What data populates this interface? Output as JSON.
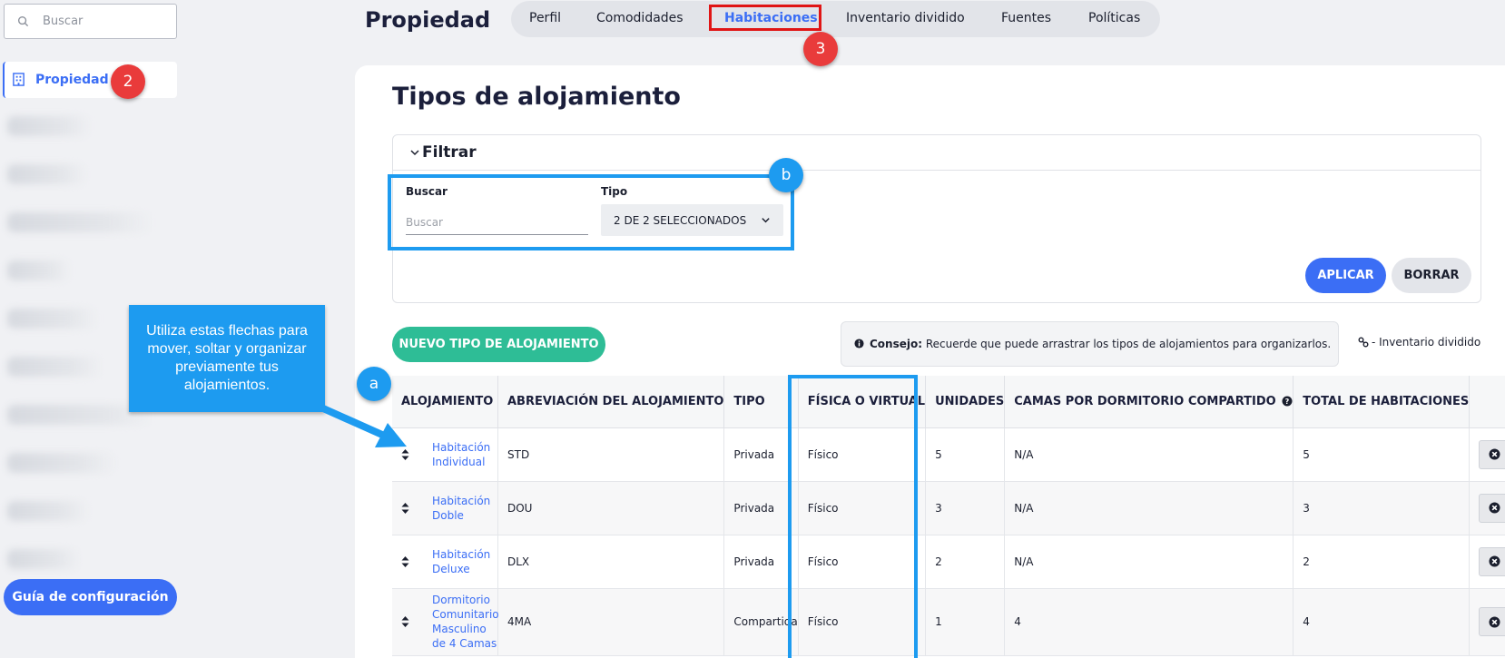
{
  "sidebar": {
    "search_placeholder": "Buscar",
    "active_item": "Propiedad",
    "guide_button": "Guía de configuración"
  },
  "header": {
    "title": "Propiedad",
    "tabs": [
      {
        "label": "Perfil"
      },
      {
        "label": "Comodidades"
      },
      {
        "label": "Habitaciones",
        "active": true
      },
      {
        "label": "Inventario dividido"
      },
      {
        "label": "Fuentes"
      },
      {
        "label": "Políticas"
      }
    ]
  },
  "main": {
    "title": "Tipos de alojamiento",
    "filter": {
      "heading": "Filtrar",
      "search_label": "Buscar",
      "search_placeholder": "Buscar",
      "type_label": "Tipo",
      "type_value": "2 DE 2 SELECCIONADOS",
      "apply": "APLICAR",
      "clear": "BORRAR"
    },
    "new_button": "NUEVO TIPO DE ALOJAMIENTO",
    "tip_bold": "Consejo:",
    "tip_text": " Recuerde que puede arrastrar los tipos de alojamientos para organizarlos.",
    "split_legend": "- Inventario dividido"
  },
  "table": {
    "headers": {
      "name": "ALOJAMIENTO",
      "abbr": "ABREVIACIÓN DEL ALOJAMIENTO",
      "type": "TIPO",
      "physical": "FÍSICA O VIRTUAL",
      "units": "UNIDADES",
      "beds": "CAMAS POR DORMITORIO COMPARTIDO",
      "total": "TOTAL DE HABITACIONES"
    },
    "rows": [
      {
        "name": "Habitación Individual",
        "abbr": "STD",
        "type": "Privada",
        "physical": "Físico",
        "units": "5",
        "beds": "N/A",
        "total": "5"
      },
      {
        "name": "Habitación Doble",
        "abbr": "DOU",
        "type": "Privada",
        "physical": "Físico",
        "units": "3",
        "beds": "N/A",
        "total": "3"
      },
      {
        "name": "Habitación Deluxe",
        "abbr": "DLX",
        "type": "Privada",
        "physical": "Físico",
        "units": "2",
        "beds": "N/A",
        "total": "2"
      },
      {
        "name": "Dormitorio Comunitario Masculino de 4 Camas",
        "abbr": "4MA",
        "type": "Compartida",
        "physical": "Físico",
        "units": "1",
        "beds": "4",
        "total": "4"
      }
    ]
  },
  "annotations": {
    "badge_2": "2",
    "badge_3": "3",
    "badge_a": "a",
    "badge_b": "b",
    "callout": "Utiliza estas flechas para mover, soltar y organizar previamente tus alojamientos."
  },
  "colors": {
    "accent": "#3b6ef5",
    "success": "#2ebd96",
    "annotation_blue": "#1d9bf0",
    "annotation_red": "#e01515"
  }
}
